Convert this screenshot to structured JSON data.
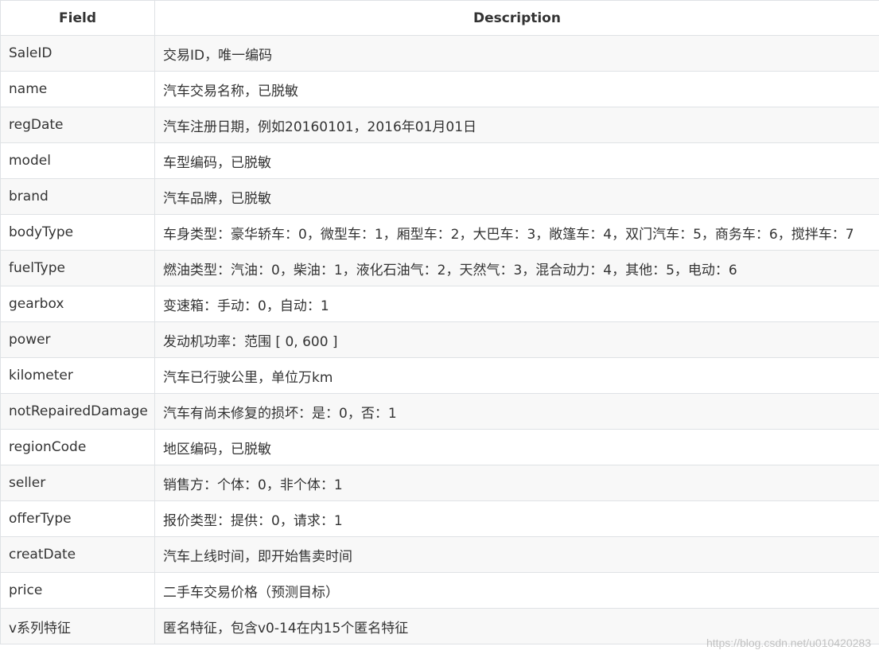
{
  "table": {
    "headers": [
      "Field",
      "Description"
    ],
    "rows": [
      {
        "field": "SaleID",
        "desc": "交易ID，唯一编码"
      },
      {
        "field": "name",
        "desc": "汽车交易名称，已脱敏"
      },
      {
        "field": "regDate",
        "desc": "汽车注册日期，例如20160101，2016年01月01日"
      },
      {
        "field": "model",
        "desc": "车型编码，已脱敏"
      },
      {
        "field": "brand",
        "desc": "汽车品牌，已脱敏"
      },
      {
        "field": "bodyType",
        "desc": "车身类型：豪华轿车：0，微型车：1，厢型车：2，大巴车：3，敞篷车：4，双门汽车：5，商务车：6，搅拌车：7"
      },
      {
        "field": "fuelType",
        "desc": "燃油类型：汽油：0，柴油：1，液化石油气：2，天然气：3，混合动力：4，其他：5，电动：6"
      },
      {
        "field": "gearbox",
        "desc": "变速箱：手动：0，自动：1"
      },
      {
        "field": "power",
        "desc": "发动机功率：范围 [ 0, 600 ]"
      },
      {
        "field": "kilometer",
        "desc": "汽车已行驶公里，单位万km"
      },
      {
        "field": "notRepairedDamage",
        "desc": "汽车有尚未修复的损坏：是：0，否：1"
      },
      {
        "field": "regionCode",
        "desc": "地区编码，已脱敏"
      },
      {
        "field": "seller",
        "desc": "销售方：个体：0，非个体：1"
      },
      {
        "field": "offerType",
        "desc": "报价类型：提供：0，请求：1"
      },
      {
        "field": "creatDate",
        "desc": "汽车上线时间，即开始售卖时间"
      },
      {
        "field": "price",
        "desc": "二手车交易价格（预测目标）"
      },
      {
        "field": "v系列特征",
        "desc": "匿名特征，包含v0-14在内15个匿名特征"
      }
    ]
  },
  "watermark": "https://blog.csdn.net/u010420283"
}
